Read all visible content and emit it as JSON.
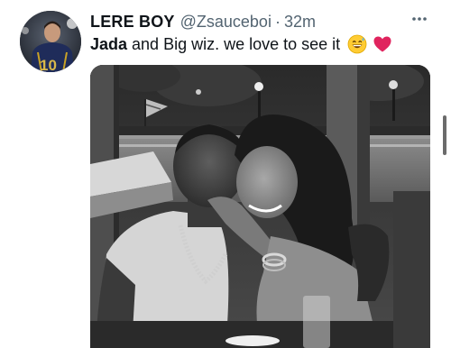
{
  "tweet": {
    "author_name": "LERE BOY",
    "author_handle": "@Zsauceboi",
    "separator": "·",
    "timestamp": "32m",
    "text_bold": "Jada",
    "text_rest": " and Big wiz. we love to see it",
    "emojis": [
      "grinning-sweat-emoji",
      "red-heart-emoji"
    ],
    "more_icon": "more-horizontal-icon"
  },
  "avatar": {
    "jersey_number": "10"
  }
}
